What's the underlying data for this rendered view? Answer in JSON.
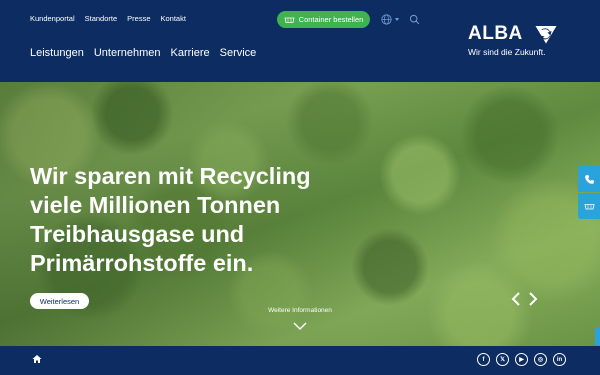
{
  "header": {
    "top_links": [
      "Kundenportal",
      "Standorte",
      "Presse",
      "Kontakt"
    ],
    "cta_label": "Container bestellen",
    "main_nav": [
      "Leistungen",
      "Unternehmen",
      "Karriere",
      "Service"
    ],
    "logo": {
      "wordmark": "ALBA",
      "tagline": "Wir sind die Zukunft."
    }
  },
  "hero": {
    "headline": "Wir sparen mit Recycling viele Millionen Tonnen Treibhausgase und Primärrohstoffe ein.",
    "button_label": "Weiterlesen",
    "more_info": "Weitere Informationen"
  },
  "footer": {
    "social": [
      {
        "name": "facebook-icon",
        "glyph": "f"
      },
      {
        "name": "x-icon",
        "glyph": "𝕏"
      },
      {
        "name": "youtube-icon",
        "glyph": "▶"
      },
      {
        "name": "instagram-icon",
        "glyph": "◎"
      },
      {
        "name": "linkedin-icon",
        "glyph": "in"
      }
    ]
  },
  "colors": {
    "navy": "#0d2d62",
    "accent_green": "#3fb34f",
    "side_blue": "#2aa3dc"
  }
}
